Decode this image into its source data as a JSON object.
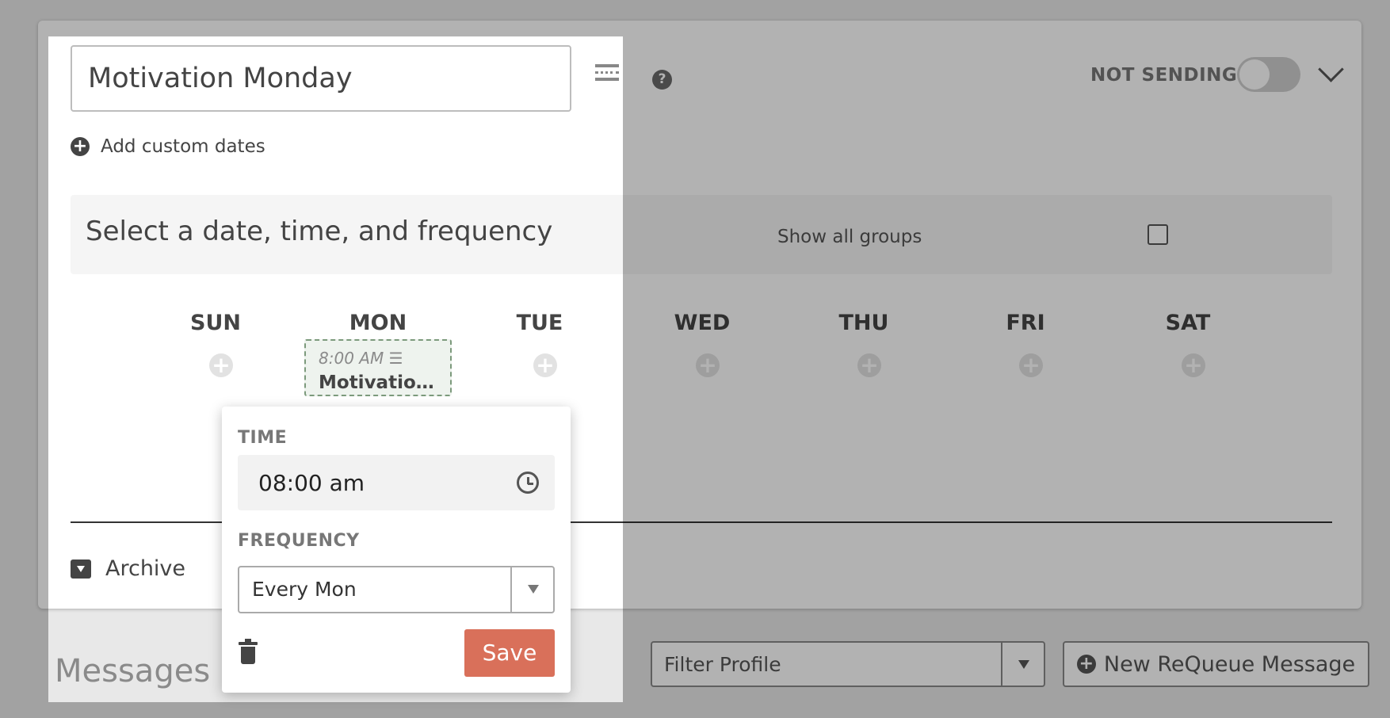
{
  "schedule": {
    "title_value": "Motivation Monday",
    "add_custom_dates_label": "Add custom dates",
    "status_label": "NOT SENDING",
    "status_toggle_on": false
  },
  "banner": {
    "title": "Select a date, time, and frequency",
    "show_all_groups_label": "Show all groups",
    "show_all_groups_checked": false
  },
  "week": {
    "days": [
      "SUN",
      "MON",
      "TUE",
      "WED",
      "THU",
      "FRI",
      "SAT"
    ],
    "slot": {
      "day": "MON",
      "time": "8:00 AM",
      "name": "Motivatio…"
    }
  },
  "footer": {
    "archive_label": "Archive",
    "messages_heading": "Messages",
    "filter_placeholder": "Filter Profile",
    "new_message_label": "New ReQueue Message"
  },
  "popover": {
    "time_label": "TIME",
    "time_value": "08:00 am",
    "frequency_label": "FREQUENCY",
    "frequency_value": "Every Mon",
    "save_label": "Save"
  },
  "colors": {
    "accent": "#d9705a",
    "slot_border": "#7c9a7c"
  },
  "icons": [
    "plus-circle-icon",
    "help-icon",
    "row-layout-icon",
    "chevron-down-icon",
    "clock-icon",
    "archive-icon",
    "trash-icon",
    "caret-down-icon"
  ]
}
